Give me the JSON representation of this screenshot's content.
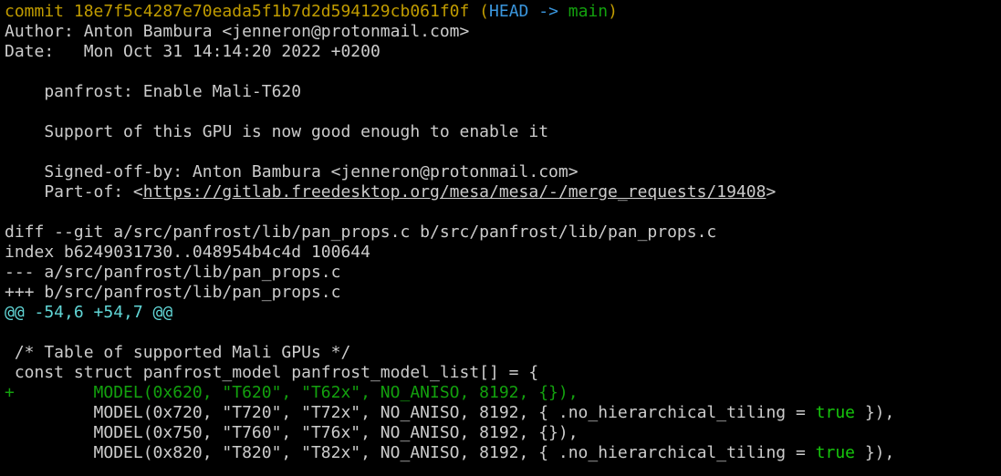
{
  "colors": {
    "background": "#000000",
    "foreground": "#cccccc",
    "commit_yellow": "#c19c00",
    "head_cyan": "#3a96dd",
    "branch_green": "#13a10e",
    "hunk_cyan": "#61d6d6",
    "added_green": "#13a10e",
    "keyword_green": "#16c60c"
  },
  "commit": {
    "prefix": "commit ",
    "hash": "18e7f5c4287e70eada5f1b7d2d594129cb061f0f",
    "paren_open": " (",
    "head": "HEAD",
    "arrow": " -> ",
    "branch": "main",
    "paren_close": ")"
  },
  "author_line": "Author: Anton Bambura <jenneron@protonmail.com>",
  "date_line": "Date:   Mon Oct 31 14:14:20 2022 +0200",
  "message": {
    "subject": "    panfrost: Enable Mali-T620",
    "body": "    Support of this GPU is now good enough to enable it",
    "signed_off": "    Signed-off-by: Anton Bambura <jenneron@protonmail.com>",
    "part_of_prefix": "    Part-of: <",
    "part_of_link": "https://gitlab.freedesktop.org/mesa/mesa/-/merge_requests/19408",
    "part_of_suffix": ">"
  },
  "diff": {
    "header": "diff --git a/src/panfrost/lib/pan_props.c b/src/panfrost/lib/pan_props.c",
    "index": "index b6249031730..048954b4c4d 100644",
    "old_file": "--- a/src/panfrost/lib/pan_props.c",
    "new_file": "+++ b/src/panfrost/lib/pan_props.c",
    "hunk": "@@ -54,6 +54,7 @@",
    "lines": {
      "comment": " /* Table of supported Mali GPUs */",
      "decl": " const struct panfrost_model panfrost_model_list[] = {",
      "added": "+        MODEL(0x620, \"T620\", \"T62x\", NO_ANISO, 8192, {}),",
      "t720_pre": "         MODEL(0x720, \"T720\", \"T72x\", NO_ANISO, 8192, { .no_hierarchical_tiling = ",
      "t720_kw": "true",
      "t720_post": " }),",
      "t760": "         MODEL(0x750, \"T760\", \"T76x\", NO_ANISO, 8192, {}),",
      "t820_pre": "         MODEL(0x820, \"T820\", \"T82x\", NO_ANISO, 8192, { .no_hierarchical_tiling = ",
      "t820_kw": "true",
      "t820_post": " }),"
    }
  }
}
